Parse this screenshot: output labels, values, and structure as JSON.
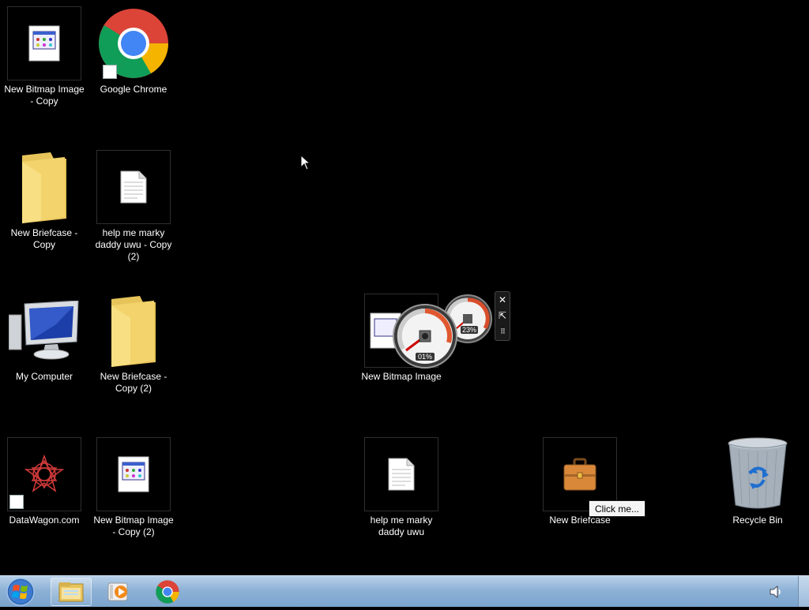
{
  "desktop": {
    "icons": [
      {
        "label": "New Bitmap Image - Copy"
      },
      {
        "label": "Google Chrome"
      },
      {
        "label": "New Briefcase - Copy"
      },
      {
        "label": "help me marky daddy uwu - Copy (2)"
      },
      {
        "label": "My Computer"
      },
      {
        "label": "New Briefcase - Copy (2)"
      },
      {
        "label": "New Bitmap Image"
      },
      {
        "label": "DataWagon.com"
      },
      {
        "label": "New Bitmap Image - Copy (2)"
      },
      {
        "label": "help me marky daddy uwu"
      },
      {
        "label": "New Briefcase"
      },
      {
        "label": "Recycle Bin"
      }
    ]
  },
  "gadget": {
    "cpu_value": "01%",
    "memory_value": "23%"
  },
  "popup_button": {
    "label": "Click me..."
  },
  "colors": {
    "desktop_background": "#000000",
    "taskbar": "#8eb2d6",
    "folder_yellow": "#f3d36b",
    "chrome_red": "#db4437",
    "chrome_green": "#0f9d58",
    "chrome_yellow": "#f4b400",
    "chrome_blue": "#4285f4"
  },
  "taskbar": {
    "items": [
      {
        "icon": "windows-start-icon"
      },
      {
        "icon": "windows-explorer-icon"
      },
      {
        "icon": "media-player-icon"
      },
      {
        "icon": "google-chrome-icon"
      },
      {
        "icon": "volume-icon"
      }
    ]
  }
}
